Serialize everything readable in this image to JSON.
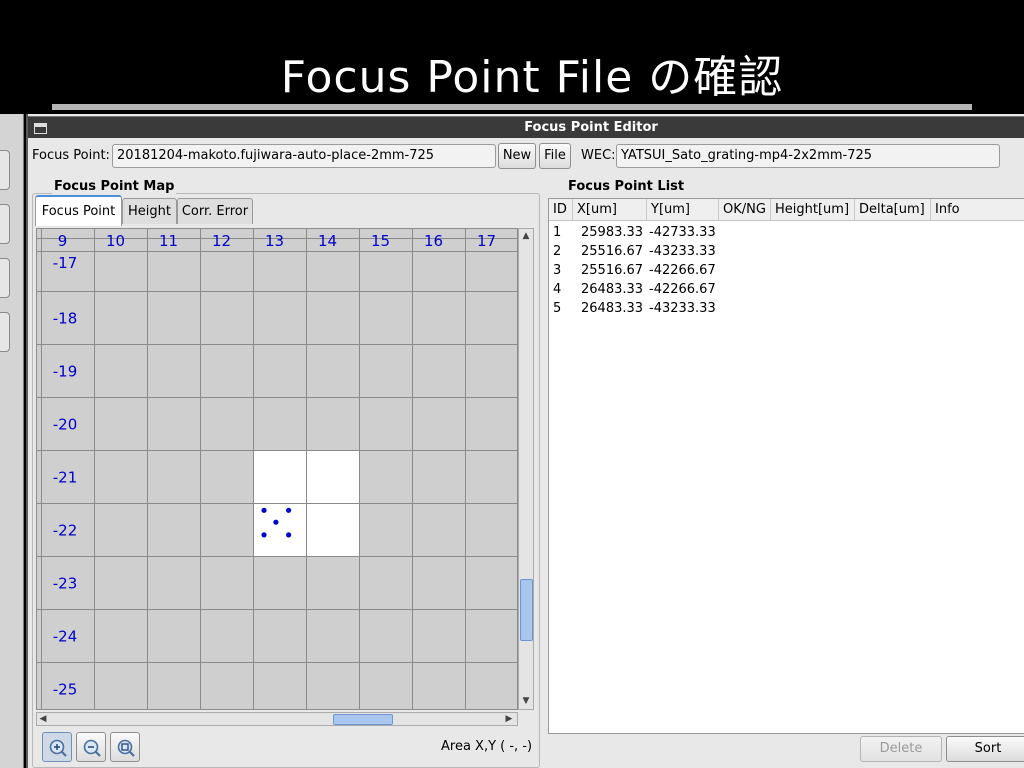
{
  "slide": {
    "title": "Focus Point File の確認"
  },
  "window": {
    "title": "Focus Point Editor"
  },
  "toolbar": {
    "focus_point_label": "Focus Point:",
    "focus_point_value": "20181204-makoto.fujiwara-auto-place-2mm-725",
    "new_label": "New",
    "file_label": "File",
    "wec_label": "WEC:",
    "wec_value": "YATSUI_Sato_grating-mp4-2x2mm-725"
  },
  "map": {
    "group_title": "Focus Point Map",
    "tabs": [
      {
        "label": "Focus Point",
        "active": true
      },
      {
        "label": "Height",
        "active": false
      },
      {
        "label": "Corr. Error",
        "active": false
      }
    ],
    "columns": [
      "9",
      "10",
      "11",
      "12",
      "13",
      "14",
      "15",
      "16",
      "17"
    ],
    "rows": [
      "-17",
      "-18",
      "-19",
      "-20",
      "-21",
      "-22",
      "-23",
      "-24",
      "-25"
    ],
    "highlighted_cells": [
      {
        "col": "13",
        "row": "-21"
      },
      {
        "col": "14",
        "row": "-21"
      },
      {
        "col": "13",
        "row": "-22"
      },
      {
        "col": "14",
        "row": "-22"
      }
    ],
    "label_color": "#0000cc",
    "point_color": "#0000cc",
    "area_label": "Area X,Y ( -, -)"
  },
  "list": {
    "group_title": "Focus Point List",
    "headers": [
      "ID",
      "X[um]",
      "Y[um]",
      "OK/NG",
      "Height[um]",
      "Delta[um]",
      "Info"
    ],
    "rows": [
      {
        "id": "1",
        "x": "25983.33",
        "y": "-42733.33",
        "ok": "",
        "height": "",
        "delta": "",
        "info": ""
      },
      {
        "id": "2",
        "x": "25516.67",
        "y": "-43233.33",
        "ok": "",
        "height": "",
        "delta": "",
        "info": ""
      },
      {
        "id": "3",
        "x": "25516.67",
        "y": "-42266.67",
        "ok": "",
        "height": "",
        "delta": "",
        "info": ""
      },
      {
        "id": "4",
        "x": "26483.33",
        "y": "-42266.67",
        "ok": "",
        "height": "",
        "delta": "",
        "info": ""
      },
      {
        "id": "5",
        "x": "26483.33",
        "y": "-43233.33",
        "ok": "",
        "height": "",
        "delta": "",
        "info": ""
      }
    ],
    "delete_label": "Delete",
    "sort_label": "Sort"
  },
  "icons": {
    "zoom_in": "zoom-in-icon",
    "zoom_out": "zoom-out-icon",
    "zoom_fit": "zoom-fit-icon"
  }
}
